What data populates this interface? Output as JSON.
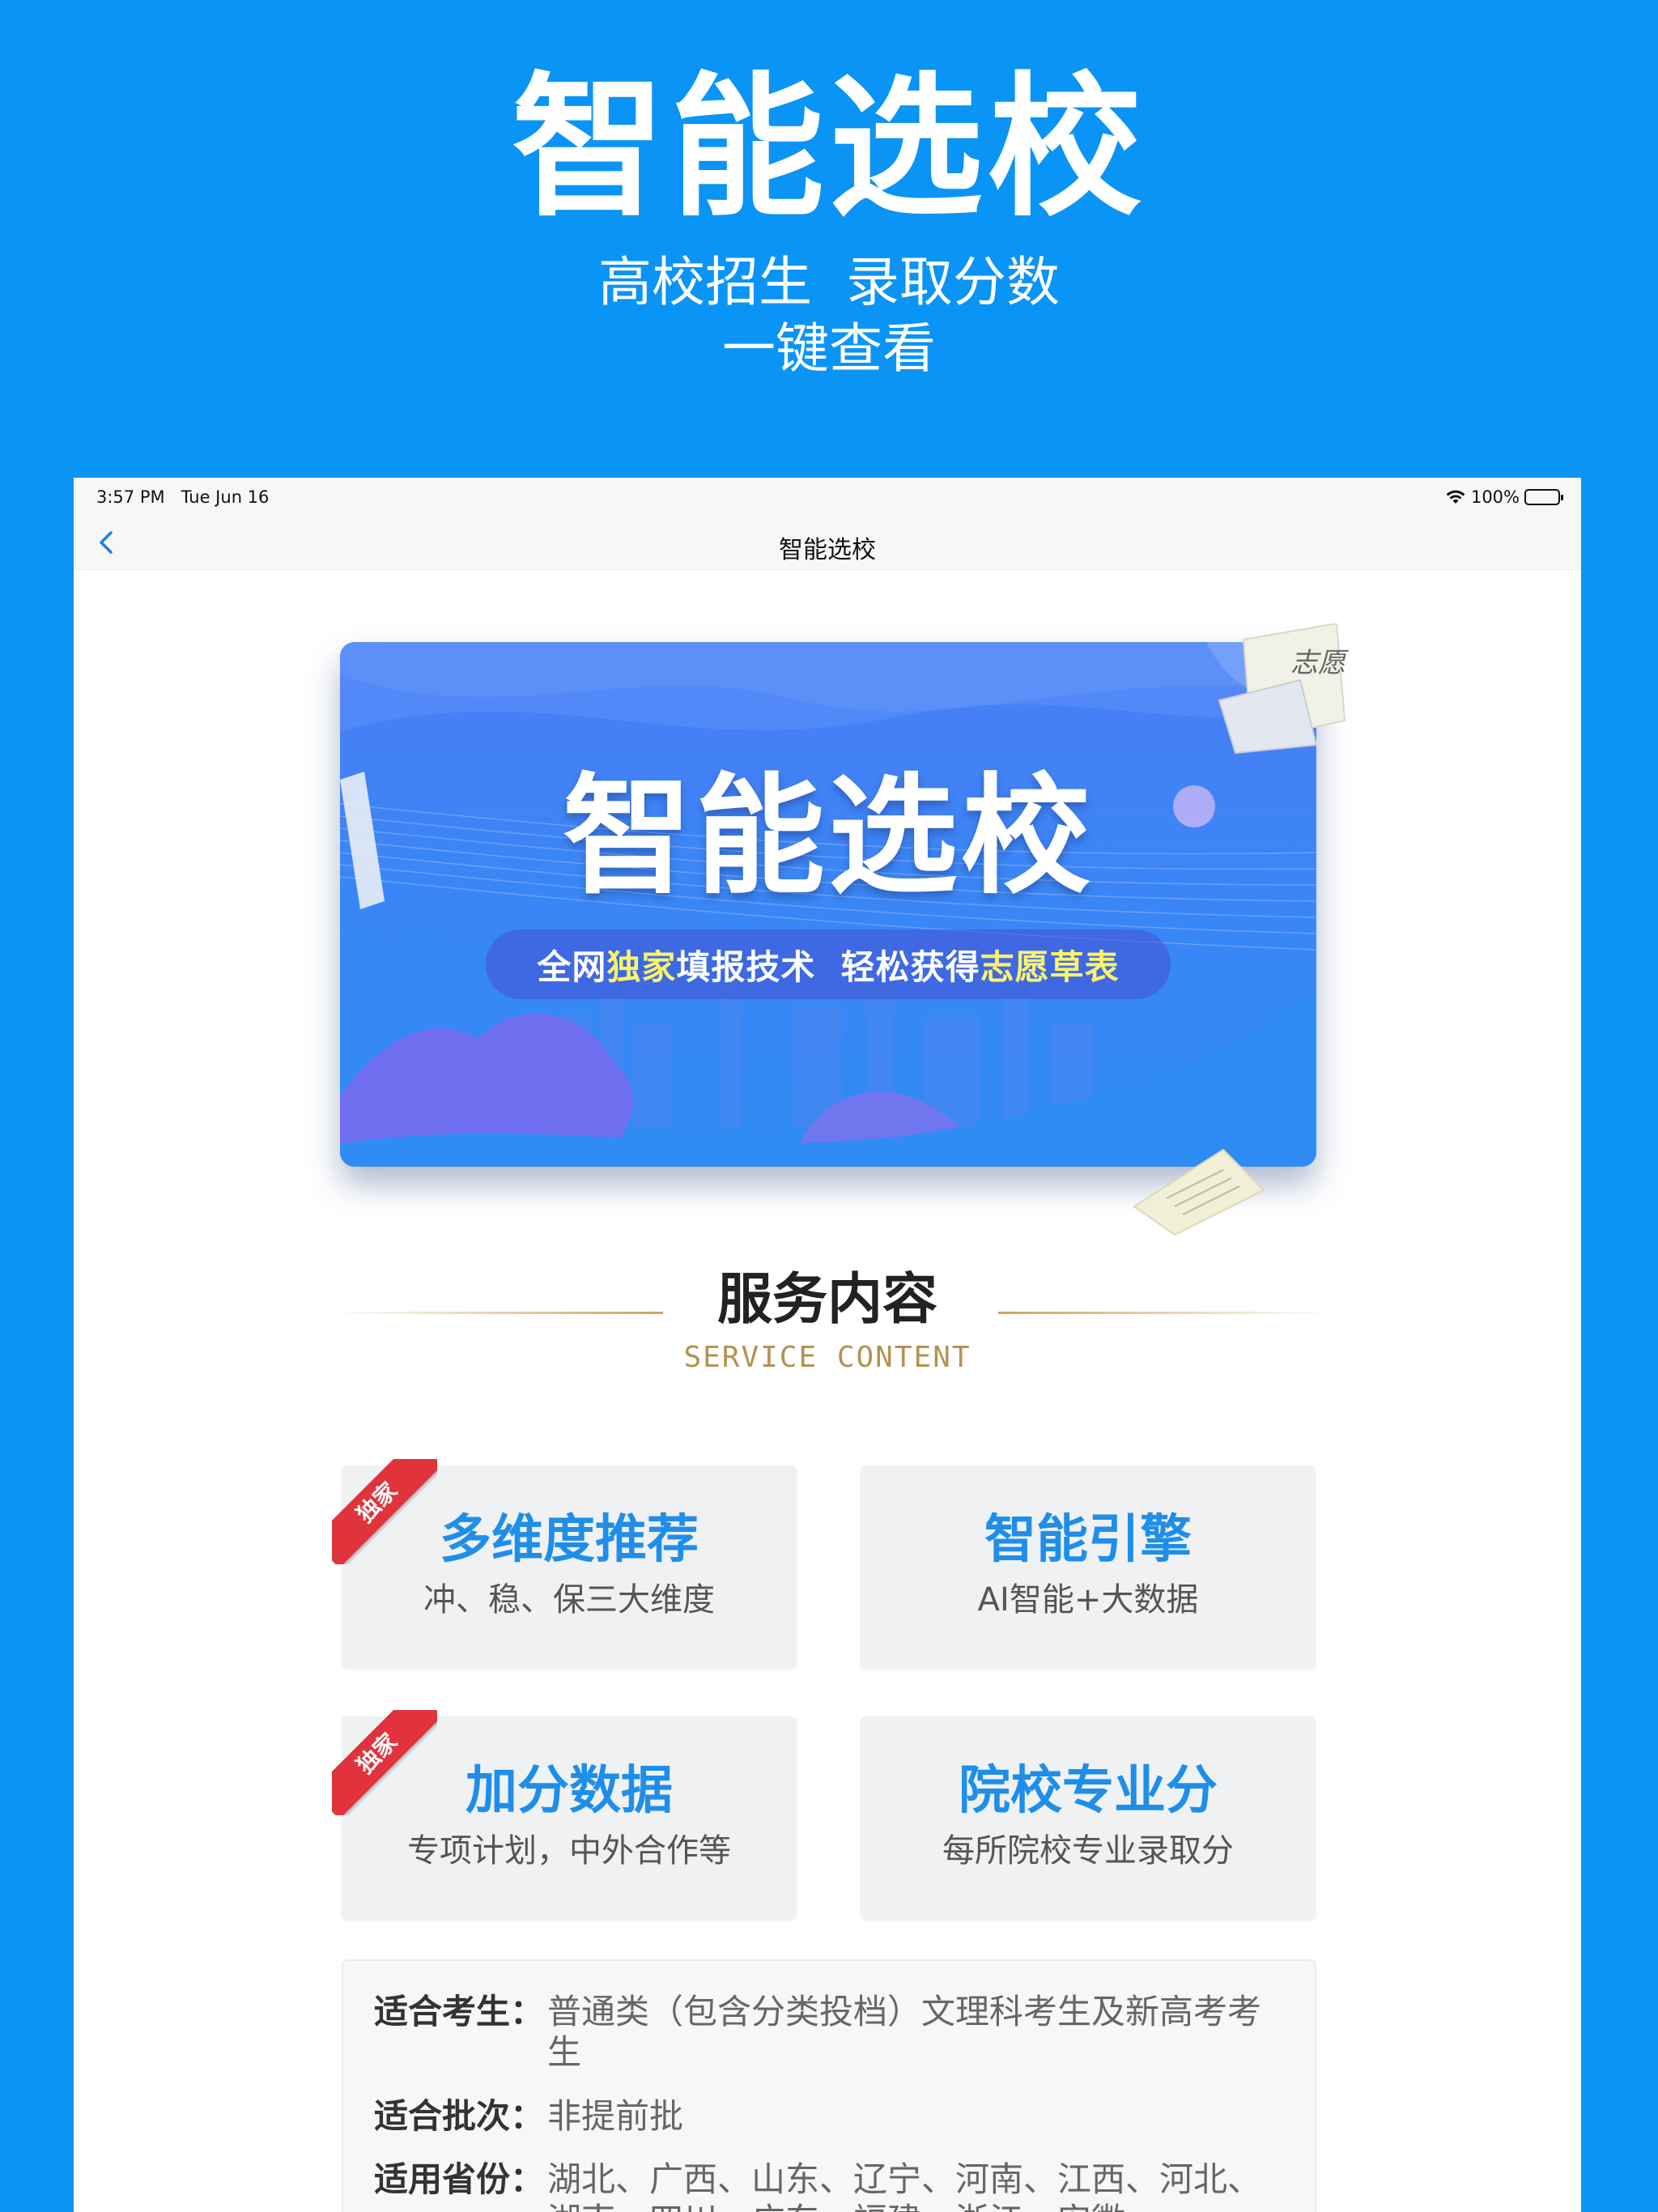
{
  "promo": {
    "title": "智能选校",
    "subtitle_line1": "高校招生  录取分数",
    "subtitle_line2": "一键查看"
  },
  "status_bar": {
    "time": "3:57 PM   Tue Jun 16",
    "battery": "100%"
  },
  "nav": {
    "title": "智能选校"
  },
  "banner": {
    "title": "智能选校",
    "tagline_part1": "全网",
    "tagline_hl1": "独家",
    "tagline_part2": "填报技术  轻松获得",
    "tagline_hl2": "志愿草表",
    "paper_text": "志愿"
  },
  "section": {
    "title": "服务内容",
    "subtitle": "SERVICE CONTENT"
  },
  "cards": [
    {
      "title": "多维度推荐",
      "desc": "冲、稳、保三大维度",
      "badge": "独家"
    },
    {
      "title": "智能引擎",
      "desc": "AI智能+大数据"
    },
    {
      "title": "加分数据",
      "desc": "专项计划，中外合作等",
      "badge": "独家"
    },
    {
      "title": "院校专业分",
      "desc": "每所院校专业录取分"
    }
  ],
  "info": {
    "rows": [
      {
        "label": "适合考生：",
        "value": "普通类（包含分类投档）文理科考生及新高考考生"
      },
      {
        "label": "适合批次：",
        "value": "非提前批"
      },
      {
        "label": "适用省份：",
        "value": "湖北、广西、山东、辽宁、河南、江西、河北、湖南、四川、广东、福建、浙江、安徽"
      }
    ]
  },
  "colors": {
    "background": "#0a94f5",
    "card_title": "#1f8eea",
    "accent_gold": "#b49252",
    "badge_red": "#e0333c",
    "tagline_highlight": "#fbf36a"
  },
  "icons": {
    "back": "chevron-left-icon",
    "wifi": "wifi-icon",
    "battery": "battery-icon"
  }
}
